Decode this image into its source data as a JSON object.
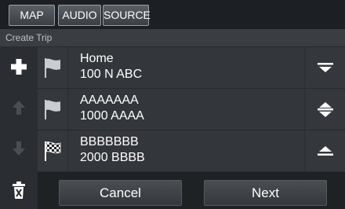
{
  "tabs": [
    {
      "label": "MAP"
    },
    {
      "label": "AUDIO"
    },
    {
      "label": "SOURCE"
    }
  ],
  "subtitle": "Create Trip",
  "destinations": [
    {
      "name": "Home",
      "address": "100 N ABC",
      "flag": "flag-icon",
      "move": "move-down-icon"
    },
    {
      "name": "AAAAAAA",
      "address": "1000 AAAA",
      "flag": "flag-icon",
      "move": "move-up-down-icon"
    },
    {
      "name": "BBBBBBB",
      "address": "2000 BBBB",
      "flag": "checkered-flag-icon",
      "move": "move-up-icon"
    }
  ],
  "buttons": {
    "cancel": "Cancel",
    "next": "Next"
  },
  "side_icons": [
    "add-icon",
    "arrow-up-icon",
    "arrow-down-icon",
    "delete-icon"
  ],
  "colors": {
    "background": "#262a2e",
    "row": "#33373b",
    "text": "#ffffff",
    "disabled_icon": "#55595e"
  }
}
